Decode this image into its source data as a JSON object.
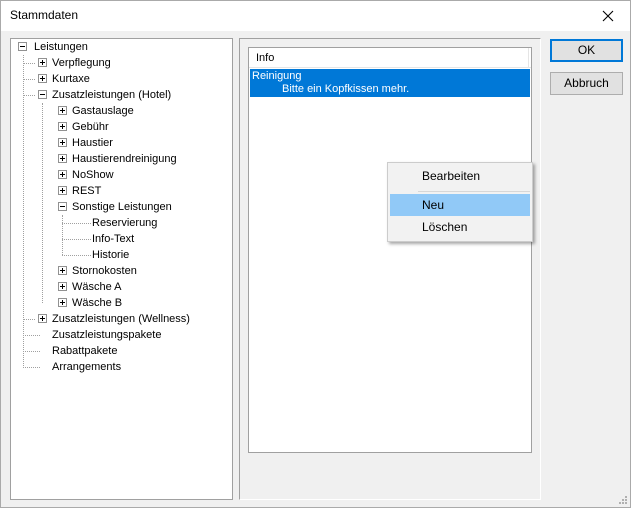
{
  "window": {
    "title": "Stammdaten"
  },
  "tree": {
    "root": "Leistungen",
    "verpflegung": "Verpflegung",
    "kurtaxe": "Kurtaxe",
    "zusatz_hotel": "Zusatzleistungen (Hotel)",
    "gastauslage": "Gastauslage",
    "gebuehr": "Gebühr",
    "haustier": "Haustier",
    "haustierendreinigung": "Haustierendreinigung",
    "noshow": "NoShow",
    "rest": "REST",
    "sonstige": "Sonstige Leistungen",
    "reservierung": "Reservierung",
    "infotext": "Info-Text",
    "historie": "Historie",
    "stornokosten": "Stornokosten",
    "waesche_a": "Wäsche A",
    "waesche_b": "Wäsche B",
    "zusatz_wellness": "Zusatzleistungen (Wellness)",
    "zusatzpakete": "Zusatzleistungspakete",
    "rabattpakete": "Rabattpakete",
    "arrangements": "Arrangements"
  },
  "list": {
    "header": "Info",
    "row": {
      "title": "Reinigung",
      "subtitle": "Bitte ein Kopfkissen mehr."
    }
  },
  "buttons": {
    "ok": "OK",
    "cancel": "Abbruch"
  },
  "context_menu": {
    "edit": "Bearbeiten",
    "new": "Neu",
    "delete": "Löschen"
  },
  "colors": {
    "selection": "#0078d7",
    "menu_hover": "#91c9f7"
  }
}
